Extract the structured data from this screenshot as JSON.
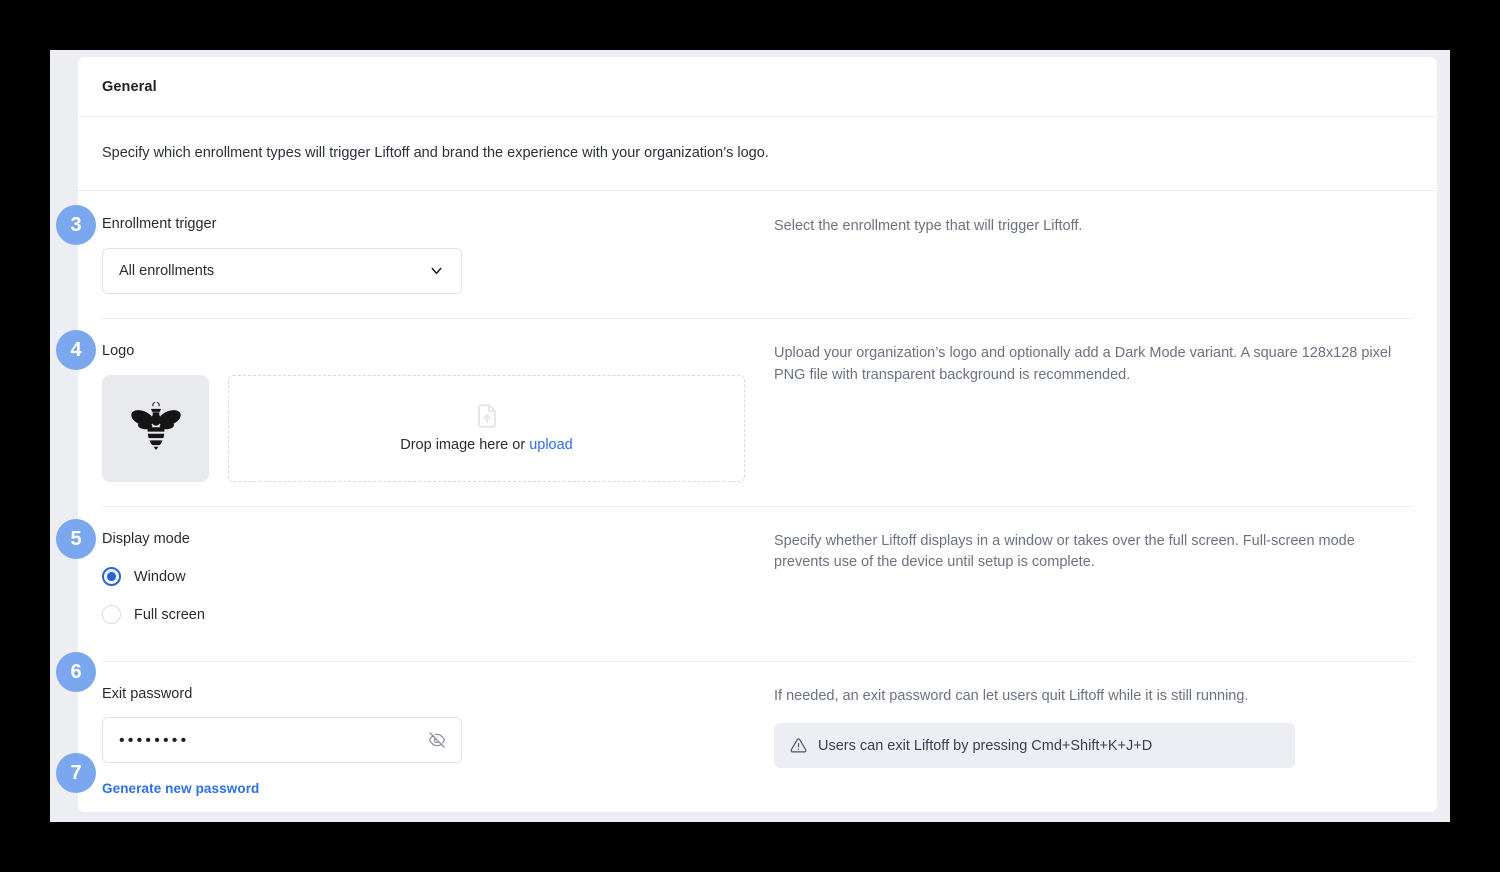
{
  "card": {
    "header_title": "General",
    "intro_text": "Specify which enrollment types will trigger Liftoff and brand the experience with your organization’s logo."
  },
  "rows": {
    "enrollment_trigger": {
      "label": "Enrollment trigger",
      "selected_value": "All enrollments",
      "help": "Select the enrollment type that will trigger Liftoff.",
      "chevron_icon": "chevron-down-icon"
    },
    "logo": {
      "label": "Logo",
      "thumb_icon": "bee-logo-icon",
      "dropzone_icon": "file-upload-icon",
      "dropzone_text": "Drop image here or ",
      "dropzone_link": "upload",
      "help": "Upload your organization’s logo and optionally add a Dark Mode variant. A square 128x128 pixel PNG file with transparent background is recommended."
    },
    "display_mode": {
      "label": "Display mode",
      "options": [
        {
          "label": "Window",
          "selected": true
        },
        {
          "label": "Full screen",
          "selected": false
        }
      ],
      "help": "Specify whether Liftoff displays in a window or takes over the full screen. Full-screen mode prevents use of the device until setup is complete."
    },
    "exit_password": {
      "label": "Exit password",
      "value_mask": "••••••••",
      "toggle_icon": "eye-off-icon",
      "generate_link": "Generate new password",
      "help": "If needed, an exit password can let users quit Liftoff while it is still running.",
      "banner": {
        "icon": "warning-triangle-icon",
        "text": "Users can exit Liftoff by pressing Cmd+Shift+K+J+D"
      }
    }
  },
  "badges": [
    {
      "number": "3"
    },
    {
      "number": "4"
    },
    {
      "number": "5"
    },
    {
      "number": "6"
    },
    {
      "number": "7"
    }
  ],
  "colors": {
    "badge_blue": "#7ba7ef",
    "link_blue": "#2f6fe4",
    "radio_blue": "#2563eb",
    "page_bg": "#eceef4",
    "card_bg": "#ffffff",
    "outer_bg": "#000000"
  }
}
